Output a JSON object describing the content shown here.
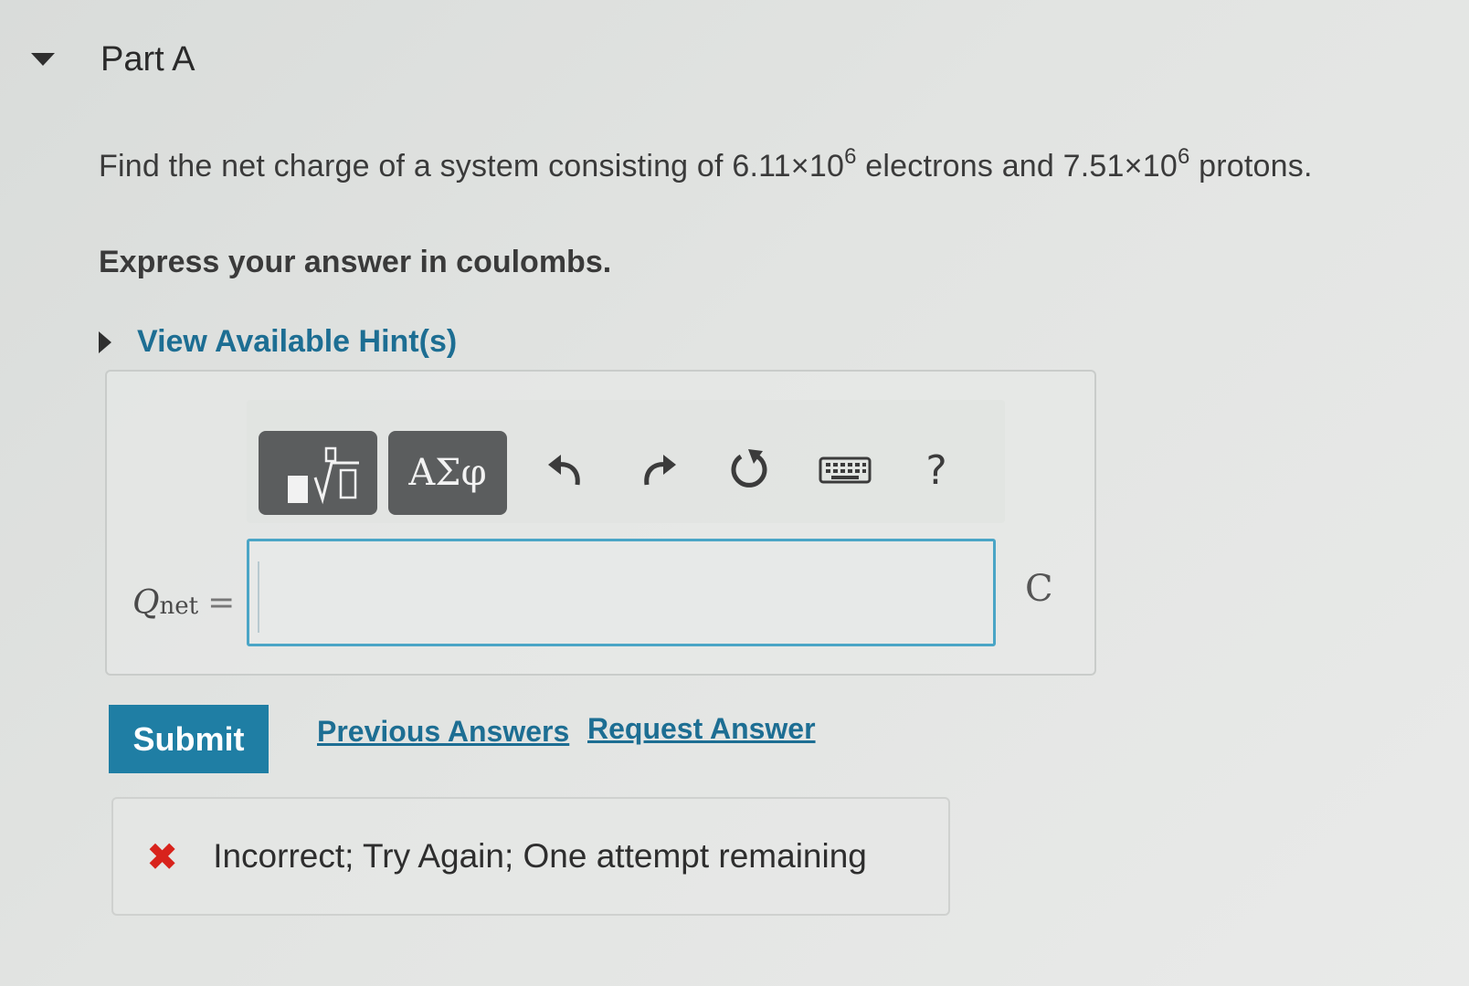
{
  "part": {
    "title": "Part A"
  },
  "question": {
    "prefix": "Find the net charge of a system consisting of ",
    "electrons_mantissa": "6.11",
    "times_ten": "×10",
    "electrons_exponent": "6",
    "middle": " electrons and ",
    "protons_mantissa": "7.51",
    "protons_exponent": "6",
    "suffix": " protons."
  },
  "instructions": "Express your answer in coulombs.",
  "hint": {
    "label": "View Available Hint(s)"
  },
  "toolbar": {
    "greek_label": "ΑΣφ",
    "help_label": "?",
    "icons": [
      "templates-icon",
      "undo-icon",
      "redo-icon",
      "reset-icon",
      "keyboard-icon"
    ]
  },
  "answer": {
    "variable": "Q",
    "variable_subscript": "net",
    "equals": "=",
    "value": "",
    "unit": "C"
  },
  "actions": {
    "submit_label": "Submit",
    "previous_answers_label": "Previous Answers",
    "request_answer_label": "Request Answer"
  },
  "feedback": {
    "icon": "x-icon",
    "text": "Incorrect; Try Again; One attempt remaining"
  },
  "colors": {
    "link": "#1d6e93",
    "submit_bg": "#1f7ea4",
    "input_border": "#4aa5c6",
    "error": "#d8231c",
    "toolbar_button": "#5b5d5e"
  }
}
